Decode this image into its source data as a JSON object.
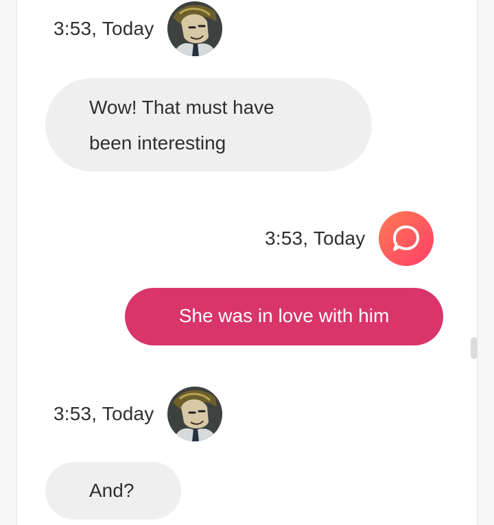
{
  "thread": {
    "messages": [
      {
        "direction": "incoming",
        "timestamp": "3:53, Today",
        "avatar_icon": "character-avatar",
        "text_lines": [
          "Wow! That must have",
          "been interesting"
        ]
      },
      {
        "direction": "outgoing",
        "timestamp": "3:53, Today",
        "avatar_icon": "chat-bubble-logo",
        "text": "She was in love with him"
      },
      {
        "direction": "incoming",
        "timestamp": "3:53, Today",
        "avatar_icon": "character-avatar",
        "text": "And?"
      }
    ]
  },
  "colors": {
    "incoming_bubble": "#efefef",
    "outgoing_bubble": "#d9356b",
    "logo_gradient_start": "#ff7b52",
    "logo_gradient_end": "#ff3e69"
  }
}
